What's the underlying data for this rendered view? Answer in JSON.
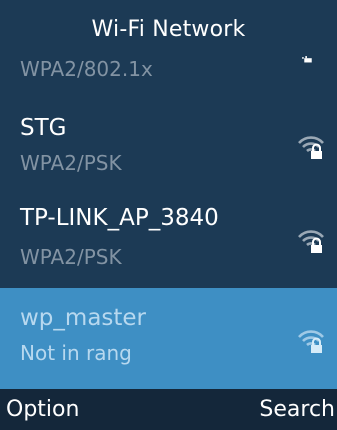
{
  "title": "Wi-Fi Network",
  "networks": [
    {
      "name": "",
      "security": "WPA2/802.1x",
      "signal_icon": "wifi-locked-icon",
      "selected": false
    },
    {
      "name": "STG",
      "security": "WPA2/PSK",
      "signal_icon": "wifi-locked-icon",
      "selected": false
    },
    {
      "name": "TP-LINK_AP_3840",
      "security": "WPA2/PSK",
      "signal_icon": "wifi-locked-icon",
      "selected": false
    },
    {
      "name": "wp_master",
      "security": "Not in rang",
      "signal_icon": "wifi-locked-icon",
      "selected": true
    }
  ],
  "softkeys": {
    "left": "Option",
    "right": "Search"
  },
  "colors": {
    "background": "#1c3a55",
    "selected_row": "#3e8fc4",
    "softkey_bar": "#14273a",
    "secondary_text": "#8293a3"
  }
}
